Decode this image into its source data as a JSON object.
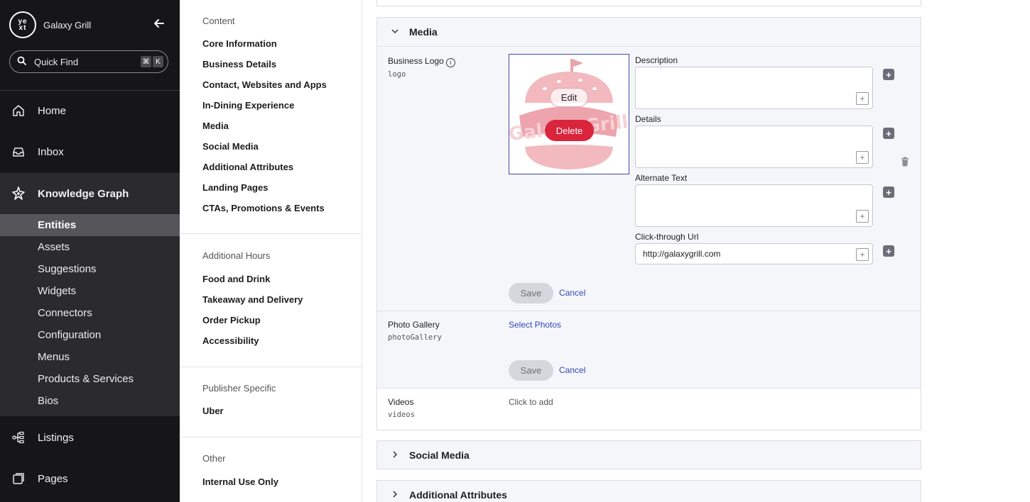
{
  "app": {
    "logo_text": "yext",
    "account_name": "Galaxy Grill",
    "quick_find": {
      "label": "Quick Find",
      "shortcut_keys": [
        "⌘",
        "K"
      ]
    }
  },
  "nav": {
    "items": [
      {
        "label": "Home",
        "icon": "home-icon"
      },
      {
        "label": "Inbox",
        "icon": "inbox-icon"
      },
      {
        "label": "Knowledge Graph",
        "icon": "knowledge-graph-icon"
      },
      {
        "label": "Listings",
        "icon": "listings-icon"
      },
      {
        "label": "Pages",
        "icon": "pages-icon"
      }
    ],
    "subitems": [
      "Entities",
      "Assets",
      "Suggestions",
      "Widgets",
      "Connectors",
      "Configuration",
      "Menus",
      "Products & Services",
      "Bios"
    ],
    "active_subitem": "Entities"
  },
  "section_nav": {
    "groups": [
      {
        "heading": "Content",
        "links": [
          "Core Information",
          "Business Details",
          "Contact, Websites and Apps",
          "In-Dining Experience",
          "Media",
          "Social Media",
          "Additional Attributes",
          "Landing Pages",
          "CTAs, Promotions & Events"
        ]
      },
      {
        "heading": "Additional Hours",
        "links": [
          "Food and Drink",
          "Takeaway and Delivery",
          "Order Pickup",
          "Accessibility"
        ]
      },
      {
        "heading": "Publisher Specific",
        "links": [
          "Uber"
        ]
      },
      {
        "heading": "Other",
        "links": [
          "Internal Use Only"
        ]
      }
    ]
  },
  "media": {
    "title": "Media",
    "business_logo": {
      "label": "Business Logo",
      "key": "logo",
      "edit_label": "Edit",
      "delete_label": "Delete",
      "logo_lettering": "Galaxy Grill",
      "fields": {
        "description_label": "Description",
        "details_label": "Details",
        "alt_text_label": "Alternate Text",
        "clickthrough_label": "Click-through Url",
        "clickthrough_value": "http://galaxygrill.com"
      },
      "save_label": "Save",
      "cancel_label": "Cancel"
    },
    "photo_gallery": {
      "label": "Photo Gallery",
      "key": "photoGallery",
      "select_label": "Select Photos",
      "save_label": "Save",
      "cancel_label": "Cancel"
    },
    "videos": {
      "label": "Videos",
      "key": "videos",
      "placeholder": "Click to add"
    }
  },
  "collapsed_sections": [
    "Social Media",
    "Additional Attributes"
  ],
  "colors": {
    "accent_blue": "#3247b8",
    "delete_red": "#d9243b",
    "nav_bg": "#161618"
  }
}
